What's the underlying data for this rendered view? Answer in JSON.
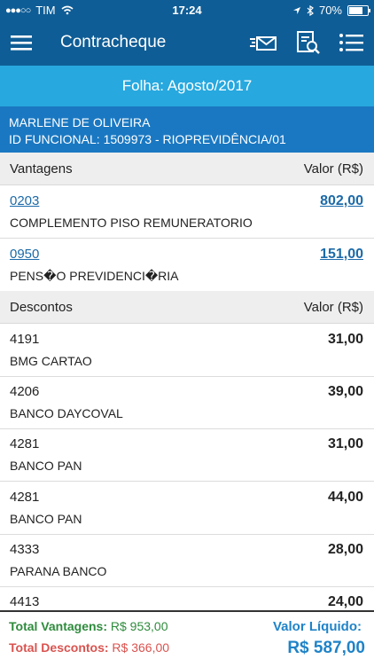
{
  "status_bar": {
    "signal": "●●●○○",
    "carrier": "TIM",
    "time": "17:24",
    "battery": "70%"
  },
  "nav": {
    "title": "Contracheque",
    "icons": [
      "menu-icon",
      "mail-icon",
      "document-search-icon",
      "list-icon"
    ]
  },
  "folha": "Folha: Agosto/2017",
  "employee": {
    "name": "MARLENE DE OLIVEIRA",
    "id_line": "ID FUNCIONAL: 1509973 - RIOPREVIDÊNCIA/01"
  },
  "vantagens": {
    "header": "Vantagens",
    "value_header": "Valor (R$)",
    "items": [
      {
        "code": "0203",
        "desc": "COMPLEMENTO PISO REMUNERATORIO",
        "value": "802,00"
      },
      {
        "code": "0950",
        "desc": "PENS�O PREVIDENCI�RIA",
        "value": "151,00"
      }
    ]
  },
  "descontos": {
    "header": "Descontos",
    "value_header": "Valor (R$)",
    "items": [
      {
        "code": "4191",
        "desc": "BMG CARTAO",
        "value": "31,00"
      },
      {
        "code": "4206",
        "desc": "BANCO DAYCOVAL",
        "value": "39,00"
      },
      {
        "code": "4281",
        "desc": "BANCO PAN",
        "value": "31,00"
      },
      {
        "code": "4281",
        "desc": "BANCO PAN",
        "value": "44,00"
      },
      {
        "code": "4333",
        "desc": "PARANA BANCO",
        "value": "28,00"
      },
      {
        "code": "4413",
        "desc": "",
        "value": "24,00"
      }
    ]
  },
  "footer": {
    "total_vantagens_label": "Total Vantagens:",
    "total_vantagens_value": "R$ 953,00",
    "total_descontos_label": "Total Descontos:",
    "total_descontos_value": "R$ 366,00",
    "liquido_label": "Valor Líquido:",
    "liquido_value": "R$ 587,00"
  },
  "colors": {
    "nav": "#0f5d96",
    "folha_bar": "#27a8df",
    "employee_bar": "#1a78c2",
    "green": "#2e8b3c",
    "red": "#d9534f",
    "liquido": "#1f83c8"
  }
}
